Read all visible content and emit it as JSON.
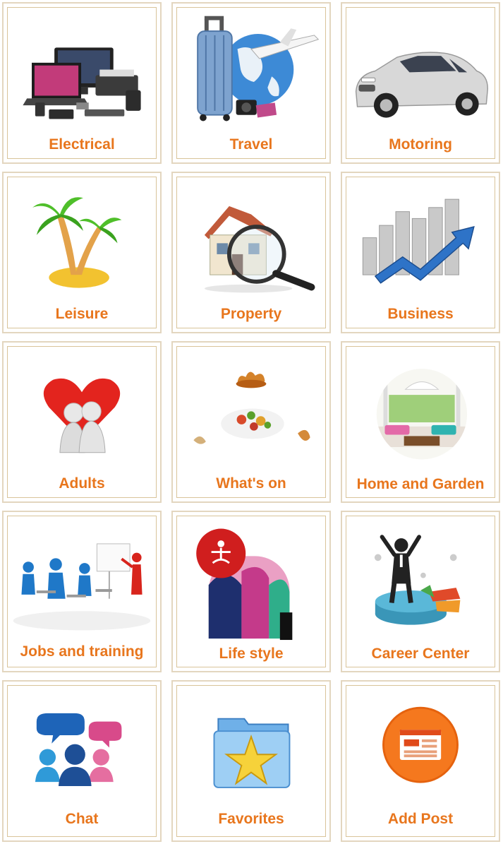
{
  "categories": [
    {
      "label": "Electrical",
      "icon": "electronics-icon"
    },
    {
      "label": "Travel",
      "icon": "suitcase-globe-icon"
    },
    {
      "label": "Motoring",
      "icon": "car-icon"
    },
    {
      "label": "Leisure",
      "icon": "palm-island-icon"
    },
    {
      "label": "Property",
      "icon": "house-magnifier-icon"
    },
    {
      "label": "Business",
      "icon": "growth-chart-icon"
    },
    {
      "label": "Adults",
      "icon": "heart-couple-icon"
    },
    {
      "label": "What's on",
      "icon": "food-dish-icon"
    },
    {
      "label": "Home and Garden",
      "icon": "patio-icon"
    },
    {
      "label": "Jobs and training",
      "icon": "classroom-icon"
    },
    {
      "label": "Life style",
      "icon": "yoga-lifestyle-icon"
    },
    {
      "label": "Career Center",
      "icon": "career-success-icon"
    },
    {
      "label": "Chat",
      "icon": "chat-people-icon"
    },
    {
      "label": "Favorites",
      "icon": "star-folder-icon"
    },
    {
      "label": "Add Post",
      "icon": "add-post-icon"
    }
  ],
  "colors": {
    "label": "#e8761d",
    "border": "#e3d6bf",
    "inner_border": "#d9c49a"
  }
}
